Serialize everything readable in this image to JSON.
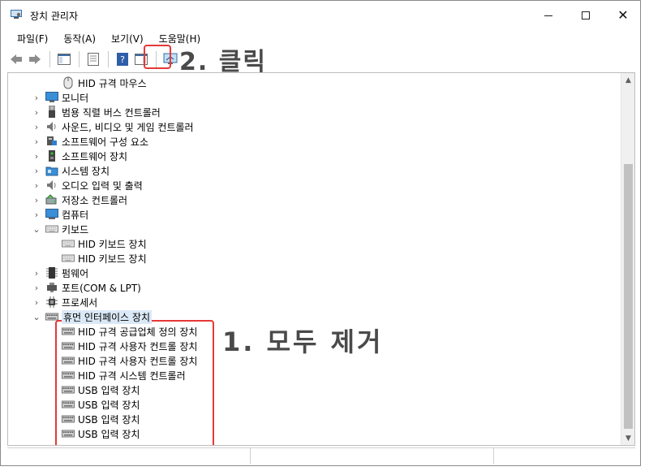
{
  "window": {
    "title": "장치 관리자"
  },
  "menu": [
    {
      "label": "파일(F)"
    },
    {
      "label": "동작(A)"
    },
    {
      "label": "보기(V)"
    },
    {
      "label": "도움말(H)"
    }
  ],
  "annotations": {
    "step2": "2. 클릭",
    "step1": "1. 모두 제거"
  },
  "tree": {
    "rows": [
      {
        "label": "HID 규격 마우스",
        "icon": "mouse-icon",
        "expander": "none",
        "indent": 1
      },
      {
        "label": "모니터",
        "icon": "monitor-icon",
        "expander": "collapsed",
        "indent": 0
      },
      {
        "label": "범용 직렬 버스 컨트롤러",
        "icon": "usb-icon",
        "expander": "collapsed",
        "indent": 0
      },
      {
        "label": "사운드, 비디오 및 게임 컨트롤러",
        "icon": "speaker-icon",
        "expander": "collapsed",
        "indent": 0
      },
      {
        "label": "소프트웨어 구성 요소",
        "icon": "software-component-icon",
        "expander": "collapsed",
        "indent": 0
      },
      {
        "label": "소프트웨어 장치",
        "icon": "software-device-icon",
        "expander": "collapsed",
        "indent": 0
      },
      {
        "label": "시스템 장치",
        "icon": "system-folder-icon",
        "expander": "collapsed",
        "indent": 0
      },
      {
        "label": "오디오 입력 및 출력",
        "icon": "speaker-icon",
        "expander": "collapsed",
        "indent": 0
      },
      {
        "label": "저장소 컨트롤러",
        "icon": "storage-icon",
        "expander": "collapsed",
        "indent": 0
      },
      {
        "label": "컴퓨터",
        "icon": "computer-icon",
        "expander": "collapsed",
        "indent": 0
      },
      {
        "label": "키보드",
        "icon": "keyboard-icon",
        "expander": "expanded",
        "indent": 0
      },
      {
        "label": "HID 키보드 장치",
        "icon": "keyboard-icon",
        "expander": "none",
        "indent": 1
      },
      {
        "label": "HID 키보드 장치",
        "icon": "keyboard-icon",
        "expander": "none",
        "indent": 1
      },
      {
        "label": "펌웨어",
        "icon": "chip-icon",
        "expander": "collapsed",
        "indent": 0
      },
      {
        "label": "포트(COM & LPT)",
        "icon": "port-icon",
        "expander": "collapsed",
        "indent": 0
      },
      {
        "label": "프로세서",
        "icon": "processor-icon",
        "expander": "collapsed",
        "indent": 0
      },
      {
        "label": "휴먼 인터페이스 장치",
        "icon": "hid-icon",
        "expander": "expanded",
        "indent": 0,
        "selected": true
      },
      {
        "label": "HID 규격 공급업체 정의 장치",
        "icon": "hid-icon",
        "expander": "none",
        "indent": 1
      },
      {
        "label": "HID 규격 사용자 컨트롤 장치",
        "icon": "hid-icon",
        "expander": "none",
        "indent": 1
      },
      {
        "label": "HID 규격 사용자 컨트롤 장치",
        "icon": "hid-icon",
        "expander": "none",
        "indent": 1
      },
      {
        "label": "HID 규격 시스템 컨트롤러",
        "icon": "hid-icon",
        "expander": "none",
        "indent": 1
      },
      {
        "label": "USB 입력 장치",
        "icon": "hid-icon",
        "expander": "none",
        "indent": 1
      },
      {
        "label": "USB 입력 장치",
        "icon": "hid-icon",
        "expander": "none",
        "indent": 1
      },
      {
        "label": "USB 입력 장치",
        "icon": "hid-icon",
        "expander": "none",
        "indent": 1
      },
      {
        "label": "USB 입력 장치",
        "icon": "hid-icon",
        "expander": "none",
        "indent": 1
      }
    ]
  },
  "colors": {
    "highlight": "#e53935",
    "annotation": "#4a4a4a",
    "selection": "#dbe9f7"
  }
}
